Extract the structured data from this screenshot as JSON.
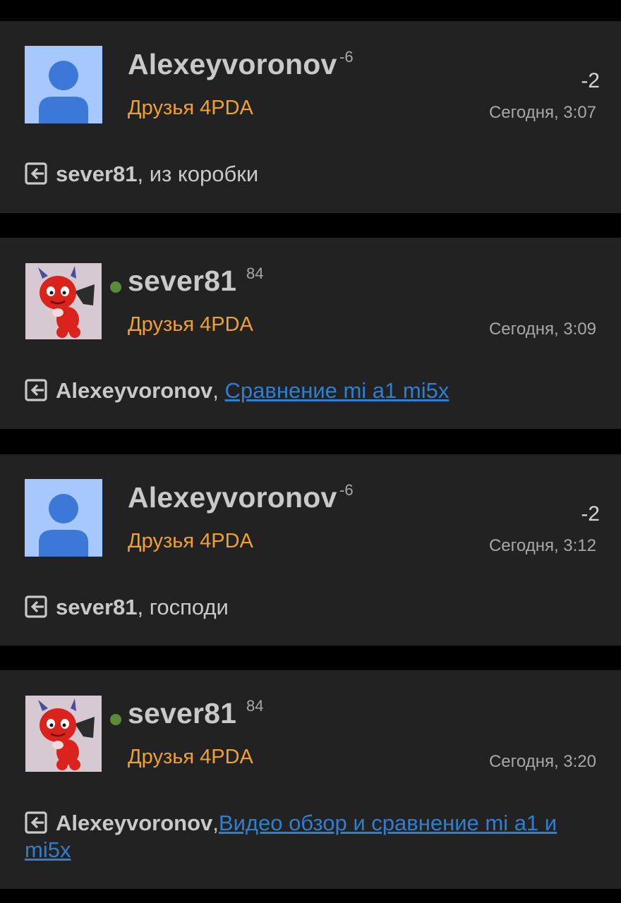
{
  "colors": {
    "background": "#000000",
    "card": "#222222",
    "username": "#c9c9c9",
    "group": "#f0a12c",
    "link": "#2f7fd0",
    "online": "#5b8c35",
    "meta": "#a8a8a8"
  },
  "posts": [
    {
      "avatar": "default-user-avatar",
      "username": "Alexeyvoronov",
      "reputation": "-6",
      "score": "-2",
      "group": "Друзья 4PDA",
      "date": "Сегодня, 3:07",
      "reply_icon": "reply-icon",
      "reply_to": "sever81",
      "separator": ",",
      "text": " из коробки",
      "link": ""
    },
    {
      "avatar": "red-devil-avatar",
      "online": true,
      "username": "sever81",
      "reputation": "84",
      "group": "Друзья 4PDA",
      "date": "Сегодня, 3:09",
      "reply_icon": "reply-icon",
      "reply_to": "Alexeyvoronov",
      "separator": ", ",
      "text": "",
      "link": "Сравнение mi a1 mi5x"
    },
    {
      "avatar": "default-user-avatar",
      "username": "Alexeyvoronov",
      "reputation": "-6",
      "score": "-2",
      "group": "Друзья 4PDA",
      "date": "Сегодня, 3:12",
      "reply_icon": "reply-icon",
      "reply_to": "sever81",
      "separator": ",",
      "text": " господи",
      "link": ""
    },
    {
      "avatar": "red-devil-avatar",
      "online": true,
      "username": "sever81",
      "reputation": "84",
      "group": "Друзья 4PDA",
      "date": "Сегодня, 3:20",
      "reply_icon": "reply-icon",
      "reply_to": "Alexeyvoronov",
      "separator": ",",
      "text": "",
      "link": "Видео обзор и сравнение mi a1 и mi5x"
    }
  ]
}
